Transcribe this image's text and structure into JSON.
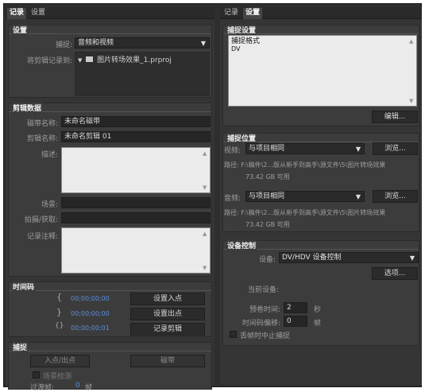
{
  "left_tabs": [
    "记录",
    "设置"
  ],
  "right_tabs": [
    "记录",
    "设置"
  ],
  "setup": {
    "title": "设置",
    "capture_label": "捕捉:",
    "capture_value": "音频和视频",
    "log_clips_label": "将剪辑记录到:",
    "log_clips_value": "图片转场效果_1.prproj"
  },
  "clip_data": {
    "title": "剪辑数据",
    "tape_label": "磁带名称:",
    "tape_value": "未命名磁带",
    "clip_label": "剪辑名称:",
    "clip_value": "未命名剪辑 01",
    "desc_label": "描述:",
    "scene_label": "场景:",
    "shot_label": "拍摄/获取:",
    "comment_label": "记录注释:"
  },
  "timecode": {
    "title": "时间码",
    "in_value": "00;00;00;00",
    "out_value": "00;00;00;00",
    "dur_value": "00;00;00;01",
    "set_in_label": "设置入点",
    "set_out_label": "设置出点",
    "log_clip_label": "记录剪辑"
  },
  "capture": {
    "title": "捕捉",
    "in_out_label": "入点/出点",
    "tape_button_label": "磁带",
    "scene_detect_label": "场景检测",
    "handles_label": "过渡帧:",
    "handles_value": "0",
    "handles_unit": "帧"
  },
  "capture_settings": {
    "title": "捕捉设置",
    "format_label": "捕捉格式",
    "format_value": "DV",
    "edit_button_label": "编辑..."
  },
  "capture_locations": {
    "title": "捕捉位置",
    "video_label": "视频:",
    "video_value": "与项目相同",
    "browse_label": "浏览...",
    "video_path": "路径: F:\\稿件\\2...版从新手到高手\\源文件\\5\\图片转场效果",
    "video_free": "73.42 GB 可用",
    "audio_label": "音频:",
    "audio_value": "与项目相同",
    "audio_path": "路径: F:\\稿件\\2...版从新手到高手\\源文件\\5\\图片转场效果",
    "audio_free": "73.42 GB 可用"
  },
  "device_control": {
    "title": "设备控制",
    "device_label": "设备:",
    "device_value": "DV/HDV 设备控制",
    "options_label": "选项...",
    "current_device_label": "当前设备:",
    "preroll_label": "预卷时间:",
    "preroll_value": "2",
    "preroll_unit": "秒",
    "offset_label": "时间码偏移:",
    "offset_value": "0",
    "offset_unit": "帧",
    "abort_label": "丢帧时中止捕捉"
  }
}
